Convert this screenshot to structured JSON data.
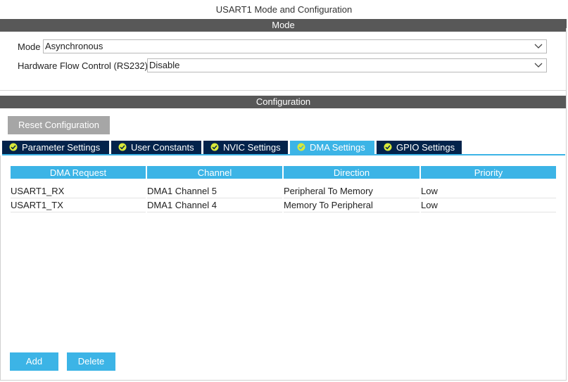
{
  "window": {
    "title": "USART1 Mode and Configuration"
  },
  "mode_section": {
    "header": "Mode",
    "mode": {
      "label": "Mode",
      "value": "Asynchronous"
    },
    "flow_control": {
      "label": "Hardware Flow Control (RS232)",
      "value": "Disable"
    }
  },
  "config_section": {
    "header": "Configuration",
    "reset_label": "Reset Configuration",
    "tabs": [
      {
        "label": "Parameter Settings",
        "active": false
      },
      {
        "label": "User Constants",
        "active": false
      },
      {
        "label": "NVIC Settings",
        "active": false
      },
      {
        "label": "DMA Settings",
        "active": true
      },
      {
        "label": "GPIO Settings",
        "active": false
      }
    ]
  },
  "dma_table": {
    "columns": [
      "DMA Request",
      "Channel",
      "Direction",
      "Priority"
    ],
    "rows": [
      [
        "USART1_RX",
        "DMA1 Channel 5",
        "Peripheral To Memory",
        "Low"
      ],
      [
        "USART1_TX",
        "DMA1 Channel 4",
        "Memory To Peripheral",
        "Low"
      ]
    ]
  },
  "actions": {
    "add_label": "Add",
    "delete_label": "Delete"
  },
  "colors": {
    "accent": "#3cb4e6",
    "tab_dark": "#03234b",
    "section_bar": "#585858",
    "button_disabled": "#a6a6a6"
  },
  "icons": {
    "tab_status": "check-circle-icon",
    "dropdown": "chevron-down-icon"
  }
}
